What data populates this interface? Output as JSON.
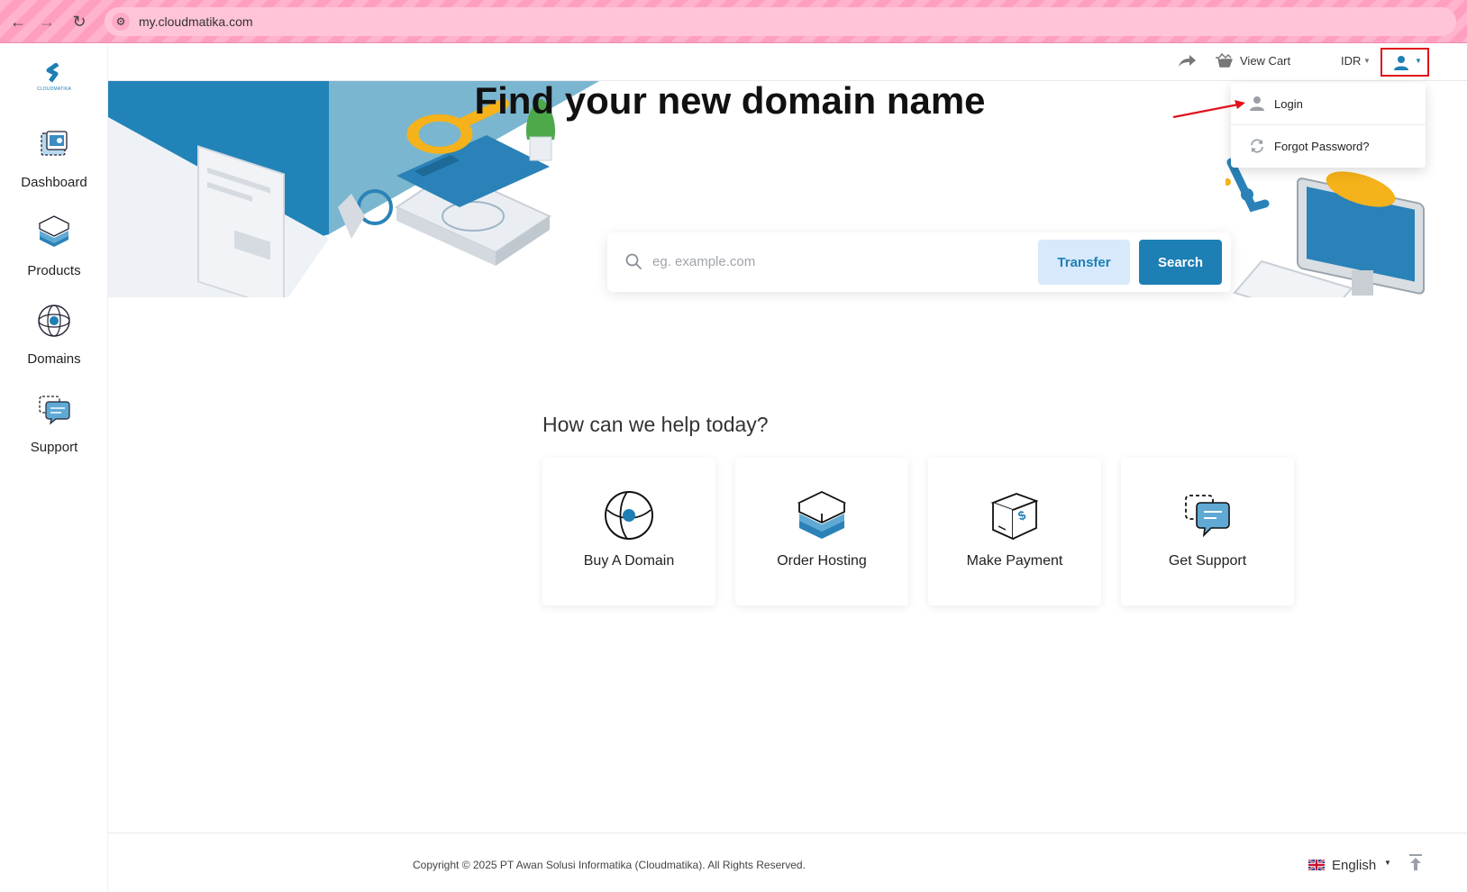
{
  "browser": {
    "url": "my.cloudmatika.com"
  },
  "brand": {
    "logo_text": "CLOUDMATIKA"
  },
  "sidebar": {
    "items": [
      {
        "label": "Dashboard"
      },
      {
        "label": "Products"
      },
      {
        "label": "Domains"
      },
      {
        "label": "Support"
      }
    ]
  },
  "header": {
    "cart_label": "View Cart",
    "currency": "IDR"
  },
  "user_menu": {
    "items": [
      {
        "label": "Login"
      },
      {
        "label": "Forgot Password?"
      }
    ]
  },
  "hero": {
    "title": "Find your new domain name",
    "search_placeholder": "eg. example.com",
    "transfer_label": "Transfer",
    "search_label": "Search"
  },
  "help": {
    "title": "How can we help today?",
    "cards": [
      {
        "label": "Buy A Domain"
      },
      {
        "label": "Order Hosting"
      },
      {
        "label": "Make Payment"
      },
      {
        "label": "Get Support"
      }
    ]
  },
  "footer": {
    "copyright": "Copyright © 2025 PT Awan Solusi Informatika (Cloudmatika). All Rights Reserved.",
    "language": "English"
  },
  "colors": {
    "brand": "#1e7fb5",
    "transfer_bg": "#d7e9fb",
    "highlight": "#e0111b",
    "browser_bar": "#ffb3cc"
  }
}
